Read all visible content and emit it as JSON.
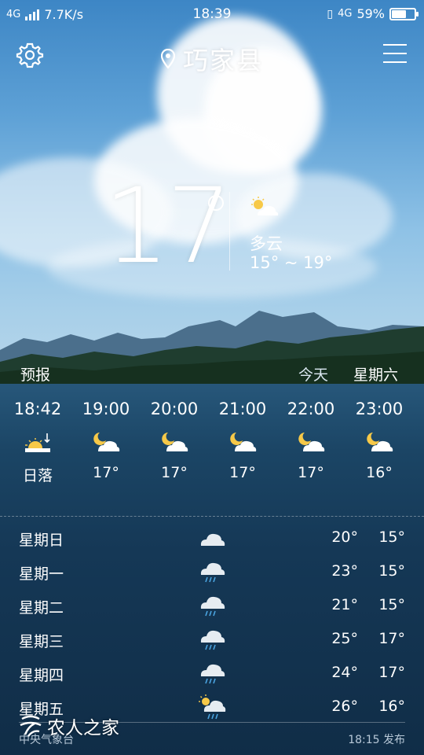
{
  "status_bar": {
    "network_left": "4G",
    "speed": "7.7K/s",
    "time": "18:39",
    "network_right": "4G",
    "battery": "59%",
    "battery_level": 0.59
  },
  "header": {
    "city": "巧家县",
    "icons": [
      "gear-icon",
      "location-pin-icon",
      "menu-icon"
    ]
  },
  "current": {
    "temperature": "17",
    "condition": "多云",
    "range": "15° ~ 19°",
    "icon": "partly-cloudy-icon"
  },
  "forecast_tabs": {
    "label": "预报",
    "today": "今天",
    "weekday": "星期六"
  },
  "hourly": [
    {
      "time": "18:42",
      "temp": "日落",
      "icon": "sunset-icon"
    },
    {
      "time": "19:00",
      "temp": "17°",
      "icon": "moon-cloud-icon"
    },
    {
      "time": "20:00",
      "temp": "17°",
      "icon": "moon-cloud-icon"
    },
    {
      "time": "21:00",
      "temp": "17°",
      "icon": "moon-cloud-icon"
    },
    {
      "time": "22:00",
      "temp": "17°",
      "icon": "moon-cloud-icon"
    },
    {
      "time": "23:00",
      "temp": "16°",
      "icon": "moon-cloud-icon"
    }
  ],
  "daily": [
    {
      "day": "星期日",
      "high": "20°",
      "low": "15°",
      "icon": "cloud-icon"
    },
    {
      "day": "星期一",
      "high": "23°",
      "low": "15°",
      "icon": "rain-cloud-icon"
    },
    {
      "day": "星期二",
      "high": "21°",
      "low": "15°",
      "icon": "rain-cloud-icon"
    },
    {
      "day": "星期三",
      "high": "25°",
      "low": "17°",
      "icon": "rain-cloud-icon"
    },
    {
      "day": "星期四",
      "high": "24°",
      "low": "17°",
      "icon": "rain-cloud-icon"
    },
    {
      "day": "星期五",
      "high": "26°",
      "low": "16°",
      "icon": "sun-rain-cloud-icon"
    }
  ],
  "footer": {
    "source": "中央气象台",
    "published": "18:15 发布"
  },
  "watermark": "农人之家"
}
